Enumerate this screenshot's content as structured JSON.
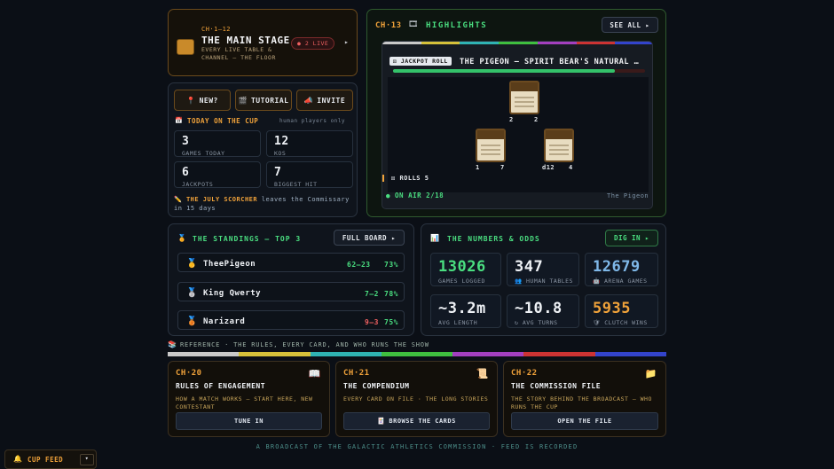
{
  "main_stage": {
    "chapter": "CH·1–12",
    "title": "THE MAIN STAGE",
    "subtitle": "EVERY LIVE TABLE & CHANNEL — THE FLOOR",
    "live_badge": "● 2 LIVE",
    "arrow": "▸"
  },
  "quick": {
    "new": "NEW?",
    "tutorial": "TUTORIAL",
    "invite": "INVITE"
  },
  "today": {
    "heading": "TODAY ON THE CUP",
    "note": "human players only",
    "stats": [
      {
        "value": "3",
        "label": "GAMES TODAY"
      },
      {
        "value": "12",
        "label": "KOS"
      },
      {
        "value": "6",
        "label": "JACKPOTS"
      },
      {
        "value": "7",
        "label": "BIGGEST HIT"
      }
    ],
    "scorcher_name": "THE JULY SCORCHER",
    "scorcher_text": "leaves the Commissary",
    "scorcher_time": "in 15 days"
  },
  "highlights": {
    "chapter": "CH·13",
    "heading": "HIGHLIGHTS",
    "see_all": "SEE ALL ▸",
    "tag": "JACKPOT ROLL",
    "headline": "THE PIGEON — SPIRIT BEAR'S NATURAL …",
    "card_vals": [
      "2",
      "2",
      "1",
      "7",
      "d12",
      "4"
    ],
    "rolls": "ROLLS 5",
    "on_air": "● ON AIR 2/18",
    "player": "The Pigeon"
  },
  "standings": {
    "heading": "THE STANDINGS — TOP 3",
    "full_board": "FULL BOARD ▸",
    "rows": [
      {
        "name": "TheePigeon",
        "record": "62–23",
        "pct": "73%"
      },
      {
        "name": "King Qwerty",
        "record": "7–2",
        "pct": "78%"
      },
      {
        "name": "Narizard",
        "record": "9–3",
        "pct": "75%"
      }
    ]
  },
  "numbers": {
    "heading": "THE NUMBERS & ODDS",
    "dig_in": "DIG IN ▸",
    "stats": [
      {
        "value": "13026",
        "label": "GAMES LOGGED"
      },
      {
        "value": "347",
        "label": "HUMAN TABLES"
      },
      {
        "value": "12679",
        "label": "ARENA GAMES"
      },
      {
        "value": "~3.2m",
        "label": "AVG LENGTH"
      },
      {
        "value": "~10.8",
        "label": "AVG TURNS"
      },
      {
        "value": "5935",
        "label": "CLUTCH WINS"
      }
    ]
  },
  "reference": {
    "label": "REFERENCE · THE RULES, EVERY CARD, AND WHO RUNS THE SHOW"
  },
  "chapters": [
    {
      "chapter": "CH·20",
      "title": "RULES OF ENGAGEMENT",
      "sub": "HOW A MATCH WORKS — START HERE, NEW CONTESTANT",
      "cta": "TUNE IN"
    },
    {
      "chapter": "CH·21",
      "title": "THE COMPENDIUM",
      "sub": "EVERY CARD ON FILE · THE LONG STORIES",
      "cta": "BROWSE THE CARDS"
    },
    {
      "chapter": "CH·22",
      "title": "THE COMMISSION FILE",
      "sub": "THE STORY BEHIND THE BROADCAST — WHO RUNS THE CUP",
      "cta": "OPEN THE FILE"
    }
  ],
  "footer": {
    "text": "A BROADCAST OF THE GALACTIC ATHLETICS COMMISSION · FEED IS RECORDED"
  },
  "feed": {
    "label": "CUP FEED",
    "toggle": "▾"
  },
  "colors": {
    "accent_orange": "#f0a23a",
    "accent_green": "#4ade80",
    "stripe": [
      "#c9c9c9",
      "#d6c13a",
      "#2fb3b3",
      "#3fbf3f",
      "#a33fbf",
      "#cc3333",
      "#3344cc"
    ]
  }
}
